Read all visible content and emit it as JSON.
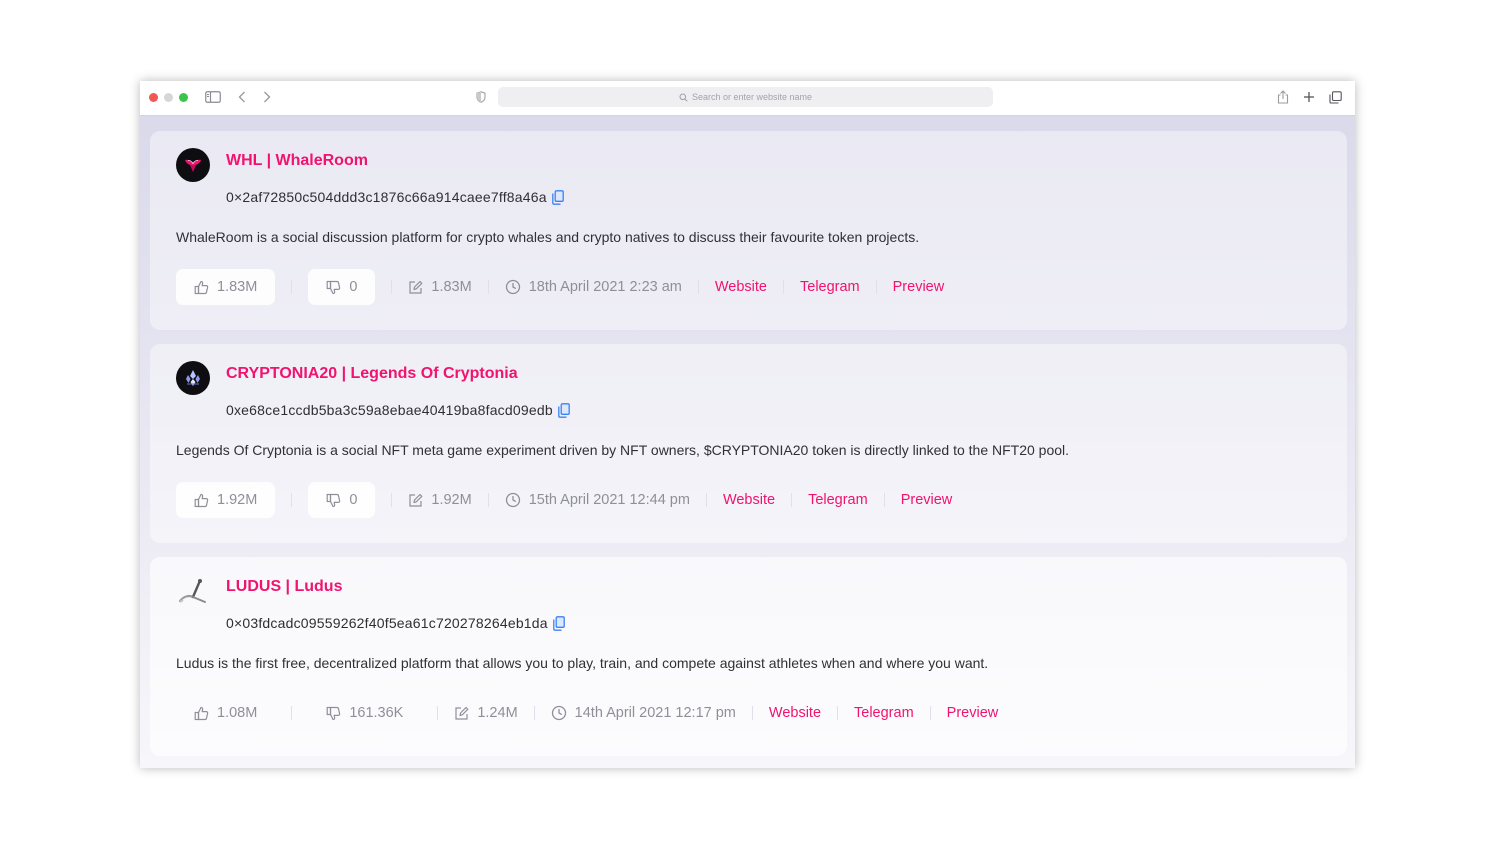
{
  "browser": {
    "address_placeholder": "Search or enter website name"
  },
  "tokens": [
    {
      "title": "WHL | WhaleRoom",
      "address": "0×2af72850c504ddd3c1876c66a914caee7ff8a46a",
      "description": "WhaleRoom is a social discussion platform for crypto whales and crypto natives to discuss their favourite token projects.",
      "likes": "1.83M",
      "dislikes": "0",
      "edits": "1.83M",
      "date": "18th April 2021 2:23 am",
      "links": [
        "Website",
        "Telegram",
        "Preview"
      ]
    },
    {
      "title": "CRYPTONIA20 | Legends Of Cryptonia",
      "address": "0xe68ce1ccdb5ba3c59a8ebae40419ba8facd09edb",
      "description": "Legends Of Cryptonia is a social NFT meta game experiment driven by NFT owners, $CRYPTONIA20 token is directly linked to the NFT20 pool.",
      "likes": "1.92M",
      "dislikes": "0",
      "edits": "1.92M",
      "date": "15th April 2021 12:44 pm",
      "links": [
        "Website",
        "Telegram",
        "Preview"
      ]
    },
    {
      "title": "LUDUS | Ludus",
      "address": "0×03fdcadc09559262f40f5ea61c720278264eb1da",
      "description": "Ludus is the first free, decentralized platform that allows you to play, train, and compete against athletes when and where you want.",
      "likes": "1.08M",
      "dislikes": "161.36K",
      "edits": "1.24M",
      "date": "14th April 2021 12:17 pm",
      "links": [
        "Website",
        "Telegram",
        "Preview"
      ]
    }
  ],
  "colors": {
    "accent": "#f0136f",
    "copy_icon": "#3b82f6",
    "muted": "#8f8f99"
  }
}
